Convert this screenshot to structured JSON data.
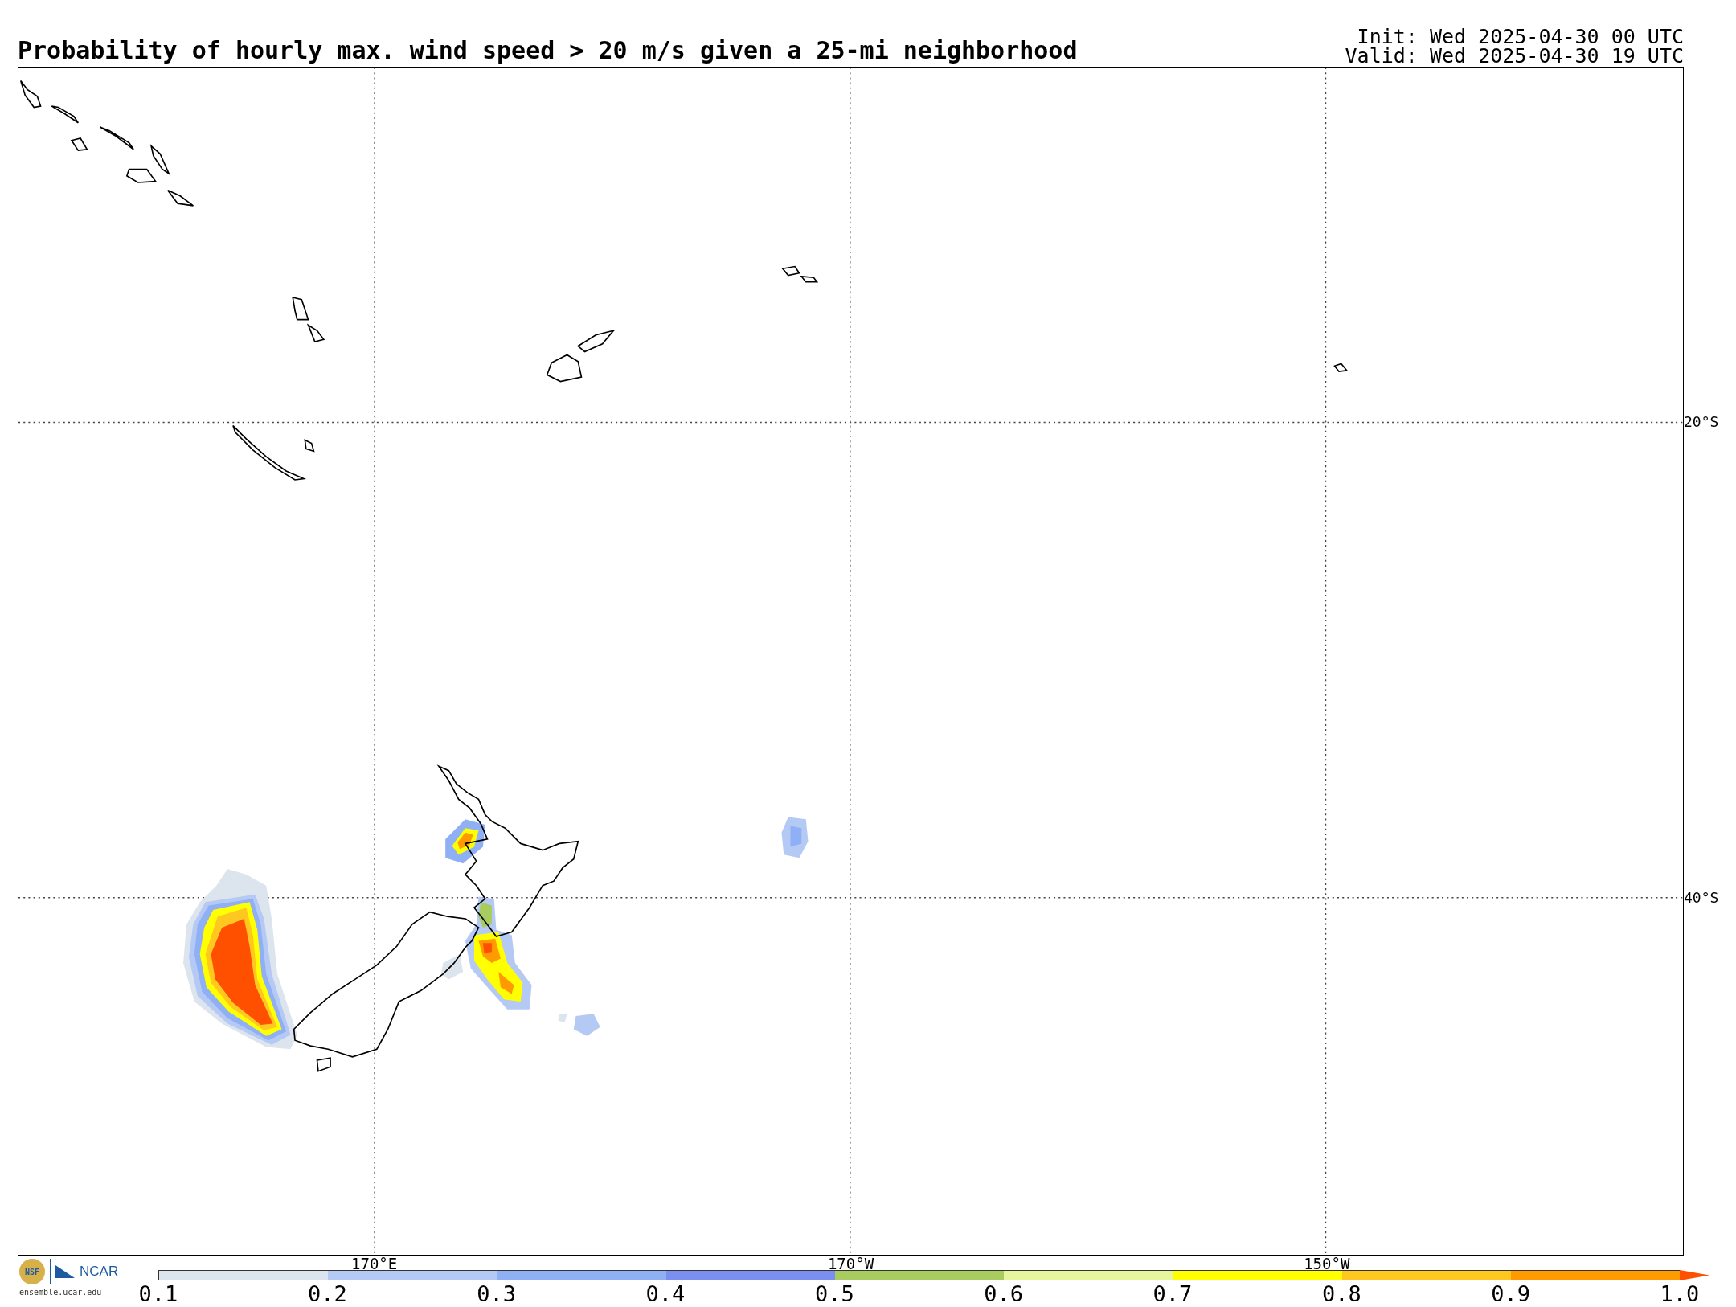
{
  "title": "Probability of hourly max. wind speed > 20 m/s given a 25-mi neighborhood",
  "run_info": [
    "Init: Wed 2025-04-30 00 UTC",
    "Valid: Wed 2025-04-30 19 UTC"
  ],
  "map": {
    "lon_labels": [
      "170°E",
      "170°W",
      "150°W"
    ],
    "lat_labels": [
      "20°S",
      "40°S"
    ]
  },
  "logo": {
    "nsf": "NSF",
    "ncar": "NCAR",
    "url": "ensemble.ucar.edu"
  },
  "colorbar": {
    "ticks": [
      "0.1",
      "0.2",
      "0.3",
      "0.4",
      "0.5",
      "0.6",
      "0.7",
      "0.8",
      "0.9",
      "1.0"
    ],
    "bins": [
      {
        "kind": "bin",
        "color": "#dce4ed"
      },
      {
        "kind": "bin",
        "color": "#b5c9f5"
      },
      {
        "kind": "bin",
        "color": "#8fb0f5"
      },
      {
        "kind": "bin",
        "color": "#7a8ff0"
      },
      {
        "kind": "bin",
        "color": "#a8cc60"
      },
      {
        "kind": "bin",
        "color": "#e6f59e"
      },
      {
        "kind": "bin",
        "color": "#ffff00"
      },
      {
        "kind": "bin",
        "color": "#ffc820"
      },
      {
        "kind": "bin",
        "color": "#ff9a00"
      },
      {
        "kind": "extend",
        "color": "#ff5000"
      }
    ]
  }
}
